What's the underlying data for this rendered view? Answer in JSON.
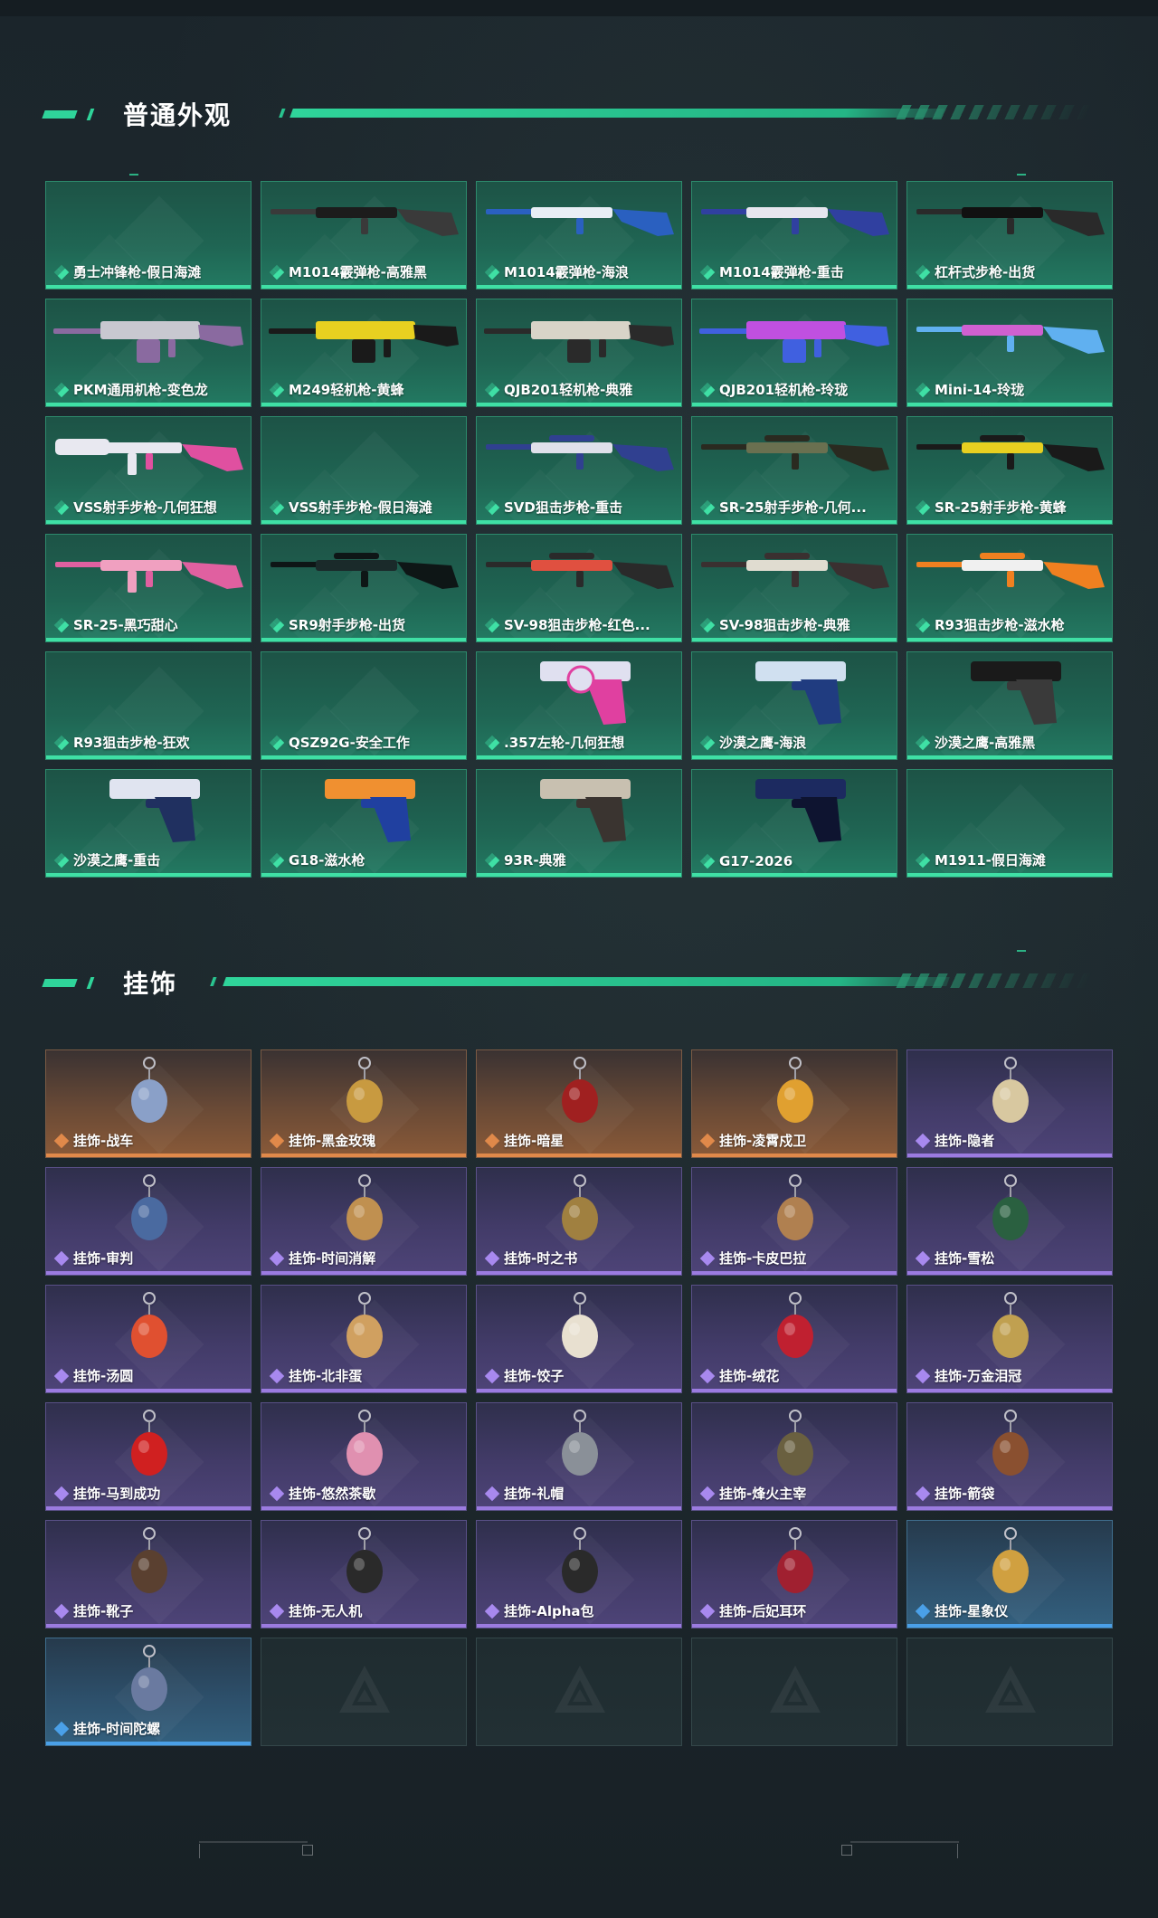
{
  "sections": {
    "skins": {
      "title": "普通外观",
      "items": [
        {
          "label": "勇士冲锋枪-假日海滩",
          "art": "none"
        },
        {
          "label": "M1014霰弹枪-高雅黑",
          "art": "shotgun",
          "c1": "#1c1c1c",
          "c2": "#3a3a3a"
        },
        {
          "label": "M1014霰弹枪-海浪",
          "art": "shotgun",
          "c1": "#e8eef5",
          "c2": "#2a60c0"
        },
        {
          "label": "M1014霰弹枪-重击",
          "art": "shotgun",
          "c1": "#e6e6ee",
          "c2": "#3040a0"
        },
        {
          "label": "杠杆式步枪-出货",
          "art": "lever",
          "c1": "#111",
          "c2": "#2a2a2a"
        },
        {
          "label": "PKM通用机枪-变色龙",
          "art": "mg",
          "c1": "#c8c8d0",
          "c2": "#8a6aa0"
        },
        {
          "label": "M249轻机枪-黄蜂",
          "art": "mg",
          "c1": "#e8d020",
          "c2": "#1a1a1a"
        },
        {
          "label": "QJB201轻机枪-典雅",
          "art": "mg",
          "c1": "#d8d4c8",
          "c2": "#2a2a2a"
        },
        {
          "label": "QJB201轻机枪-玲珑",
          "art": "mg",
          "c1": "#c050e0",
          "c2": "#4060e0"
        },
        {
          "label": "Mini-14-玲珑",
          "art": "rifle",
          "c1": "#d060d0",
          "c2": "#60b0f0"
        },
        {
          "label": "VSS射手步枪-几何狂想",
          "art": "vss",
          "c1": "#e8e8f0",
          "c2": "#e050a0"
        },
        {
          "label": "VSS射手步枪-假日海滩",
          "art": "none"
        },
        {
          "label": "SVD狙击步枪-重击",
          "art": "sniper",
          "c1": "#e0e0ea",
          "c2": "#304090"
        },
        {
          "label": "SR-25射手步枪-几何...",
          "art": "sniper",
          "c1": "#6a7050",
          "c2": "#2a2a20"
        },
        {
          "label": "SR-25射手步枪-黄蜂",
          "art": "sniper",
          "c1": "#e8d020",
          "c2": "#1a1a1a"
        },
        {
          "label": "SR-25-黑巧甜心",
          "art": "ar",
          "c1": "#f0a0c0",
          "c2": "#e060a0"
        },
        {
          "label": "SR9射手步枪-出货",
          "art": "sniper",
          "c1": "#1a2a2a",
          "c2": "#0e1616"
        },
        {
          "label": "SV-98狙击步枪-红色...",
          "art": "sniper",
          "c1": "#e05040",
          "c2": "#2a2a2a"
        },
        {
          "label": "SV-98狙击步枪-典雅",
          "art": "sniper",
          "c1": "#e0dcd0",
          "c2": "#3a3030"
        },
        {
          "label": "R93狙击步枪-滋水枪",
          "art": "sniper",
          "c1": "#f0f0f0",
          "c2": "#f08020"
        },
        {
          "label": "R93狙击步枪-狂欢",
          "art": "none"
        },
        {
          "label": "QSZ92G-安全工作",
          "art": "none"
        },
        {
          "label": ".357左轮-几何狂想",
          "art": "revolver",
          "c1": "#e0e0f0",
          "c2": "#e040a0"
        },
        {
          "label": "沙漠之鹰-海浪",
          "art": "pistol",
          "c1": "#d0e0f0",
          "c2": "#203c80"
        },
        {
          "label": "沙漠之鹰-高雅黑",
          "art": "pistol",
          "c1": "#1a1a1a",
          "c2": "#3a3a3a"
        },
        {
          "label": "沙漠之鹰-重击",
          "art": "pistol",
          "c1": "#e0e4f0",
          "c2": "#203060"
        },
        {
          "label": "G18-滋水枪",
          "art": "pistol",
          "c1": "#f09030",
          "c2": "#2040a0"
        },
        {
          "label": "93R-典雅",
          "art": "pistol",
          "c1": "#c8c0b0",
          "c2": "#3a3430"
        },
        {
          "label": "G17-2026",
          "art": "pistol",
          "c1": "#1c2a60",
          "c2": "#0e1430"
        },
        {
          "label": "M1911-假日海滩",
          "art": "none"
        }
      ]
    },
    "charms": {
      "title": "挂饰",
      "items": [
        {
          "label": "挂饰-战车",
          "rarity": "orange",
          "color": "#8aa0c8"
        },
        {
          "label": "挂饰-黑金玫瑰",
          "rarity": "orange",
          "color": "#c89a40"
        },
        {
          "label": "挂饰-暗星",
          "rarity": "orange",
          "color": "#a02020"
        },
        {
          "label": "挂饰-凌霄戍卫",
          "rarity": "orange",
          "color": "#e0a030"
        },
        {
          "label": "挂饰-隐者",
          "rarity": "purple",
          "color": "#d8c8a0"
        },
        {
          "label": "挂饰-审判",
          "rarity": "purple",
          "color": "#4a6aa0"
        },
        {
          "label": "挂饰-时间消解",
          "rarity": "purple",
          "color": "#c09050"
        },
        {
          "label": "挂饰-时之书",
          "rarity": "purple",
          "color": "#a08040"
        },
        {
          "label": "挂饰-卡皮巴拉",
          "rarity": "purple",
          "color": "#b08050"
        },
        {
          "label": "挂饰-雪松",
          "rarity": "purple",
          "color": "#2a6040"
        },
        {
          "label": "挂饰-汤圆",
          "rarity": "purple",
          "color": "#e05030"
        },
        {
          "label": "挂饰-北非蛋",
          "rarity": "purple",
          "color": "#d0a060"
        },
        {
          "label": "挂饰-饺子",
          "rarity": "purple",
          "color": "#e8e0d0"
        },
        {
          "label": "挂饰-绒花",
          "rarity": "purple",
          "color": "#c02030"
        },
        {
          "label": "挂饰-万金泪冠",
          "rarity": "purple",
          "color": "#c0a050"
        },
        {
          "label": "挂饰-马到成功",
          "rarity": "purple",
          "color": "#d02020"
        },
        {
          "label": "挂饰-悠然茶歇",
          "rarity": "purple",
          "color": "#e090b0"
        },
        {
          "label": "挂饰-礼帽",
          "rarity": "purple",
          "color": "#8a9098"
        },
        {
          "label": "挂饰-烽火主宰",
          "rarity": "purple",
          "color": "#6a6040"
        },
        {
          "label": "挂饰-箭袋",
          "rarity": "purple",
          "color": "#8a5030"
        },
        {
          "label": "挂饰-靴子",
          "rarity": "purple",
          "color": "#5a4030"
        },
        {
          "label": "挂饰-无人机",
          "rarity": "purple",
          "color": "#2a2a2a"
        },
        {
          "label": "挂饰-Alpha包",
          "rarity": "purple",
          "color": "#2a2a2a"
        },
        {
          "label": "挂饰-后妃耳环",
          "rarity": "purple",
          "color": "#a02030"
        },
        {
          "label": "挂饰-星象仪",
          "rarity": "blue",
          "color": "#d0a040"
        },
        {
          "label": "挂饰-时间陀螺",
          "rarity": "blue",
          "color": "#6a7aa0"
        },
        {
          "label": "",
          "rarity": "empty"
        },
        {
          "label": "",
          "rarity": "empty"
        },
        {
          "label": "",
          "rarity": "empty"
        },
        {
          "label": "",
          "rarity": "empty"
        }
      ]
    }
  },
  "icons": {
    "rarity": "rarity-diamond-icon",
    "empty_slot": "triangle-logo-icon"
  }
}
